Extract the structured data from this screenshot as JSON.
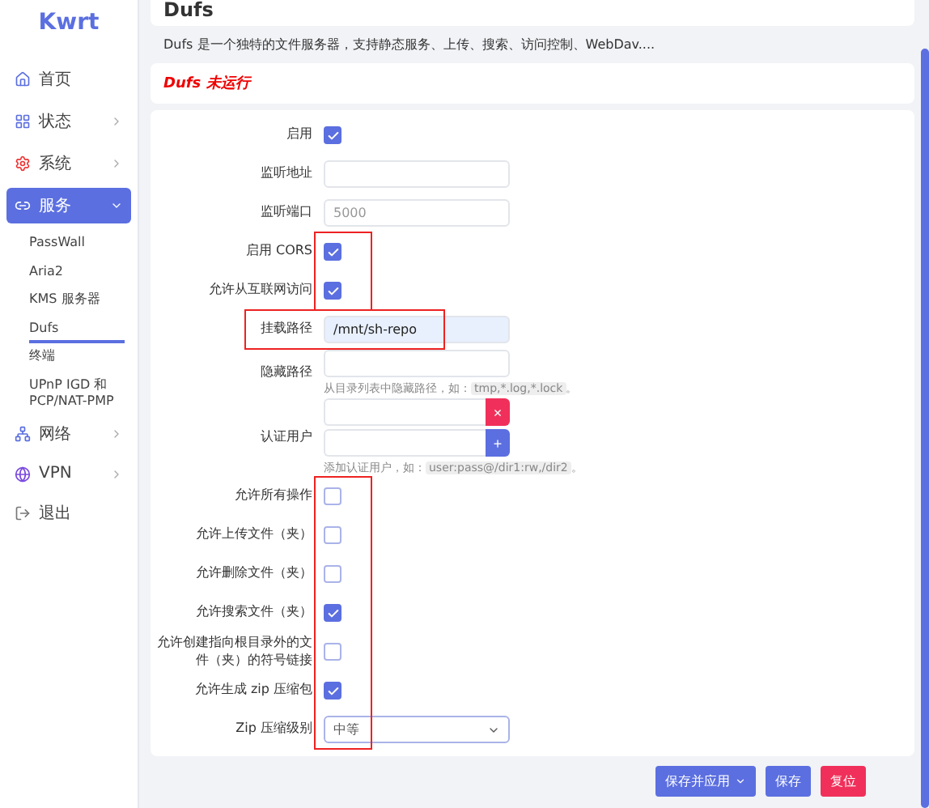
{
  "sidebar": {
    "logo": "Kwrt",
    "items": [
      {
        "label": "首页",
        "has_children": false,
        "selected": false
      },
      {
        "label": "状态",
        "has_children": true,
        "expanded": false,
        "selected": false
      },
      {
        "label": "系统",
        "has_children": true,
        "expanded": false,
        "selected": false
      },
      {
        "label": "服务",
        "has_children": true,
        "expanded": true,
        "selected": true,
        "children": [
          {
            "label": "PassWall",
            "selected": false
          },
          {
            "label": "Aria2",
            "selected": false
          },
          {
            "label": "KMS 服务器",
            "selected": false
          },
          {
            "label": "Dufs",
            "selected": true
          },
          {
            "label": "终端",
            "selected": false
          },
          {
            "label": "UPnP IGD 和 PCP/NAT-PMP",
            "selected": false
          }
        ]
      },
      {
        "label": "网络",
        "has_children": true,
        "expanded": false,
        "selected": false
      },
      {
        "label": "VPN",
        "has_children": true,
        "expanded": false,
        "selected": false
      },
      {
        "label": "退出",
        "has_children": false,
        "selected": false
      }
    ]
  },
  "page": {
    "title": "Dufs",
    "description": "Dufs 是一个独特的文件服务器，支持静态服务、上传、搜索、访问控制、WebDav....",
    "status": "Dufs 未运行"
  },
  "form": {
    "groups": [
      {
        "highlighted": false,
        "fields": [
          {
            "kind": "checkbox",
            "label": "启用",
            "checked": true
          },
          {
            "kind": "text",
            "label": "监听地址",
            "autofilled": false
          },
          {
            "kind": "text",
            "label": "监听端口",
            "placeholder": "5000",
            "autofilled": false
          }
        ]
      },
      {
        "highlighted": true,
        "fields": [
          {
            "kind": "checkbox",
            "label": "启用 CORS",
            "checked": true
          },
          {
            "kind": "checkbox",
            "label": "允许从互联网访问",
            "checked": true
          }
        ]
      },
      {
        "highlighted": true,
        "fields": [
          {
            "kind": "text",
            "label": "挂载路径",
            "value": "/mnt/sh-repo",
            "autofilled": true
          }
        ]
      },
      {
        "highlighted": false,
        "fields": [
          {
            "kind": "text",
            "label": "隐藏路径",
            "autofilled": false,
            "hint": {
              "text": "从目录列表中隐藏路径，如：",
              "code": "tmp,*.log,*.lock",
              "end": "。"
            }
          },
          {
            "kind": "list",
            "label": "认证用户",
            "entries": [
              {
                "action": "×",
                "kind": "remove"
              },
              {
                "action": "+",
                "kind": "add"
              }
            ],
            "hint": {
              "text": "添加认证用户，如：",
              "code": "user:pass@/dir1:rw,/dir2",
              "end": "。"
            }
          }
        ]
      },
      {
        "highlighted": true,
        "fields": [
          {
            "kind": "checkbox",
            "label": "允许所有操作",
            "checked": false
          },
          {
            "kind": "checkbox",
            "label": "允许上传文件（夹）",
            "checked": false
          },
          {
            "kind": "checkbox",
            "label": "允许删除文件（夹）",
            "checked": false
          },
          {
            "kind": "checkbox",
            "label": "允许搜索文件（夹）",
            "checked": true
          },
          {
            "kind": "checkbox",
            "label": "允许创建指向根目录外的文件（夹）的符号链接",
            "checked": false
          },
          {
            "kind": "checkbox",
            "label": "允许生成 zip 压缩包",
            "checked": true
          },
          {
            "kind": "select",
            "label": "Zip 压缩级别",
            "value": "中等"
          }
        ]
      }
    ]
  },
  "buttons": [
    {
      "label": "保存并应用",
      "kind": "primary",
      "dropdown": true
    },
    {
      "label": "保存",
      "kind": "primary",
      "dropdown": false
    },
    {
      "label": "复位",
      "kind": "danger",
      "dropdown": false
    }
  ]
}
